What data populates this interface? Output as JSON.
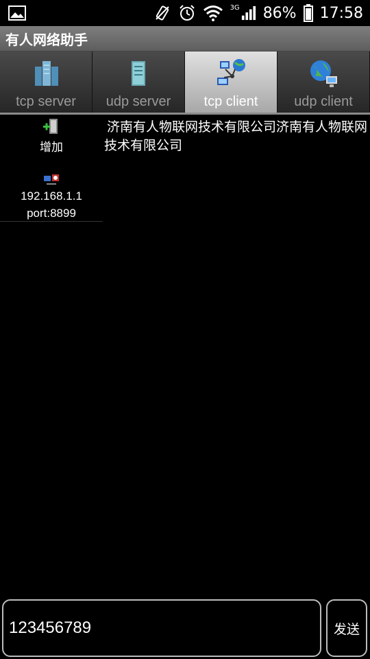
{
  "status_bar": {
    "battery": "86%",
    "time": "17:58",
    "network": "3G",
    "icons": [
      "gallery-icon",
      "vibrate-icon",
      "alarm-icon",
      "wifi-icon",
      "signal-icon",
      "battery-icon"
    ]
  },
  "app": {
    "title": "有人网络助手"
  },
  "tabs": [
    {
      "label": "tcp server",
      "icon": "server-tower-icon",
      "active": false
    },
    {
      "label": "udp server",
      "icon": "server-cabinet-icon",
      "active": false
    },
    {
      "label": "tcp client",
      "icon": "network-computers-icon",
      "active": true
    },
    {
      "label": "udp client",
      "icon": "globe-computer-icon",
      "active": false
    }
  ],
  "sidebar": {
    "add_label": "增加",
    "connections": [
      {
        "ip": "192.168.1.1",
        "port": "port:8899"
      }
    ]
  },
  "received_text": "济南有人物联网技术有限公司济南有人物联网技术有限公司",
  "send": {
    "input_value": "123456789",
    "button_label": "发送"
  },
  "colors": {
    "background": "#000000",
    "appbar": "#6e6e6e",
    "active_tab": "#c8c8c8",
    "input_border": "#bdbdbd"
  }
}
